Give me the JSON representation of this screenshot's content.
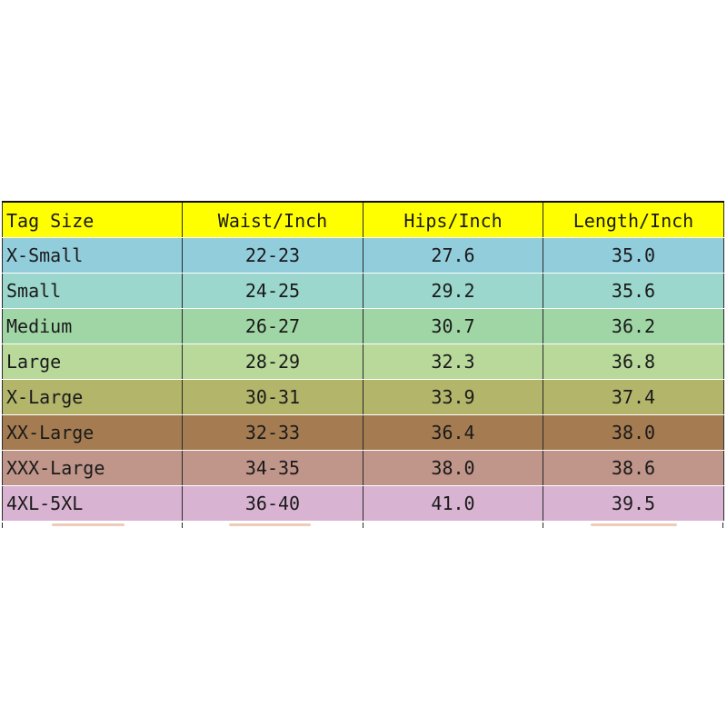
{
  "table": {
    "headers": [
      "Tag Size",
      "Waist/Inch",
      "Hips/Inch",
      "Length/Inch"
    ],
    "header_color": "#ffff00",
    "rows": [
      {
        "cells": [
          "X-Small",
          "22-23",
          "27.6",
          "35.0"
        ],
        "color": "#92cddc"
      },
      {
        "cells": [
          "Small",
          "24-25",
          "29.2",
          "35.6"
        ],
        "color": "#9bd7cc"
      },
      {
        "cells": [
          "Medium",
          "26-27",
          "30.7",
          "36.2"
        ],
        "color": "#a0d6a6"
      },
      {
        "cells": [
          "Large",
          "28-29",
          "32.3",
          "36.8"
        ],
        "color": "#b8d99a"
      },
      {
        "cells": [
          "X-Large",
          "30-31",
          "33.9",
          "37.4"
        ],
        "color": "#b2b56a"
      },
      {
        "cells": [
          "XX-Large",
          "32-33",
          "36.4",
          "38.0"
        ],
        "color": "#a57c52"
      },
      {
        "cells": [
          "XXX-Large",
          "34-35",
          "38.0",
          "38.6"
        ],
        "color": "#c0958a"
      },
      {
        "cells": [
          "4XL-5XL",
          "36-40",
          "41.0",
          "39.5"
        ],
        "color": "#d8b4d2"
      }
    ]
  }
}
